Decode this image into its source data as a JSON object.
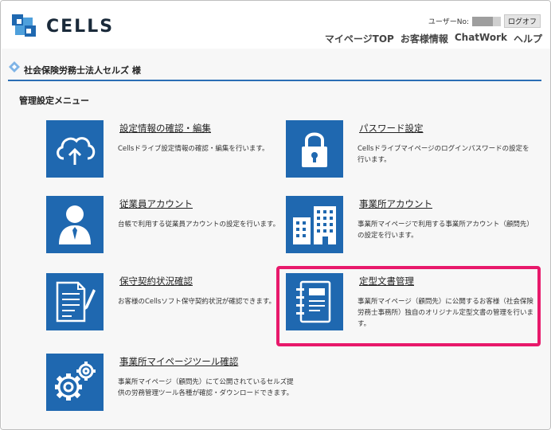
{
  "header": {
    "logo_text": "CELLS",
    "user_label": "ユーザーNo:",
    "logout_label": "ログオフ",
    "nav": [
      "マイページTOP",
      "お客様情報",
      "ChatWork",
      "ヘルプ"
    ]
  },
  "company_name": "社会保険労務士法人セルズ 様",
  "menu_title": "管理設定メニュー",
  "cards": [
    {
      "title": "設定情報の確認・編集",
      "desc": "Cellsドライブ設定情報の確認・編集を行います。",
      "icon": "cloud-upload-icon"
    },
    {
      "title": "パスワード設定",
      "desc": "Cellsドライブマイページのログインパスワードの設定を行います。",
      "icon": "lock-icon"
    },
    {
      "title": "従業員アカウント",
      "desc": "台帳で利用する従業員アカウントの設定を行います。",
      "icon": "employee-icon"
    },
    {
      "title": "事業所アカウント",
      "desc": "事業所マイページで利用する事業所アカウント（顧問先）の設定を行います。",
      "icon": "building-icon"
    },
    {
      "title": "保守契約状況確認",
      "desc": "お客様のCellsソフト保守契約状況が確認できます。",
      "icon": "document-pen-icon"
    },
    {
      "title": "定型文書管理",
      "desc": "事業所マイページ（顧問先）に公開するお客様（社会保険労務士事務所）独自のオリジナル定型文書の管理を行います。",
      "icon": "notebook-icon"
    },
    {
      "title": "事業所マイページツール確認",
      "desc": "事業所マイページ（顧問先）にて公開されているセルズ提供の労務管理ツール各種が確認・ダウンロードできます。",
      "icon": "gears-icon"
    }
  ],
  "colors": {
    "tile": "#1f68b0",
    "accent_line": "#2b6eb5",
    "highlight": "#e8196b"
  }
}
